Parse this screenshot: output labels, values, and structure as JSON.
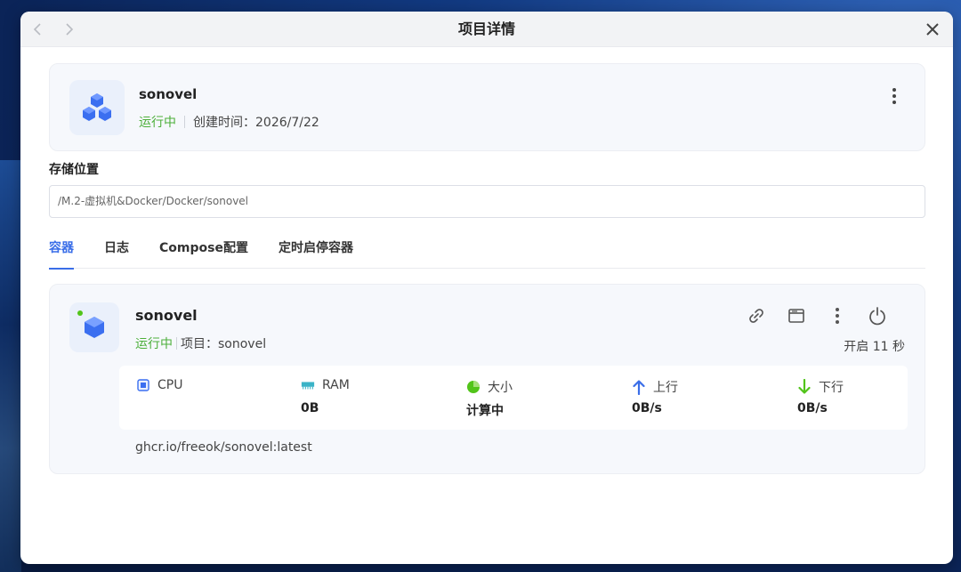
{
  "window": {
    "title": "项目详情"
  },
  "project": {
    "name": "sonovel",
    "status": "运行中",
    "created_text": "创建时间：2026/7/22"
  },
  "storage": {
    "label": "存储位置",
    "path": "/M.2-虚拟机&Docker/Docker/sonovel"
  },
  "tabs": [
    {
      "label": "容器",
      "active": true
    },
    {
      "label": "日志",
      "active": false
    },
    {
      "label": "Compose配置",
      "active": false
    },
    {
      "label": "定时启停容器",
      "active": false
    }
  ],
  "container": {
    "name": "sonovel",
    "status": "运行中",
    "project_text": "项目：sonovel",
    "uptime": "开启 11 秒",
    "image": "ghcr.io/freeok/sonovel:latest",
    "stats": [
      {
        "label": "CPU",
        "value": "",
        "icon": "cpu-icon"
      },
      {
        "label": "RAM",
        "value": "0B",
        "icon": "ram-icon"
      },
      {
        "label": "大小",
        "value": "计算中",
        "icon": "pie-chart-icon"
      },
      {
        "label": "上行",
        "value": "0B/s",
        "icon": "arrow-up-icon"
      },
      {
        "label": "下行",
        "value": "0B/s",
        "icon": "arrow-down-icon"
      }
    ]
  },
  "colors": {
    "accent": "#3a6ee8",
    "running": "#4caf3a",
    "upload": "#3a6ee8",
    "download": "#52c41a"
  }
}
